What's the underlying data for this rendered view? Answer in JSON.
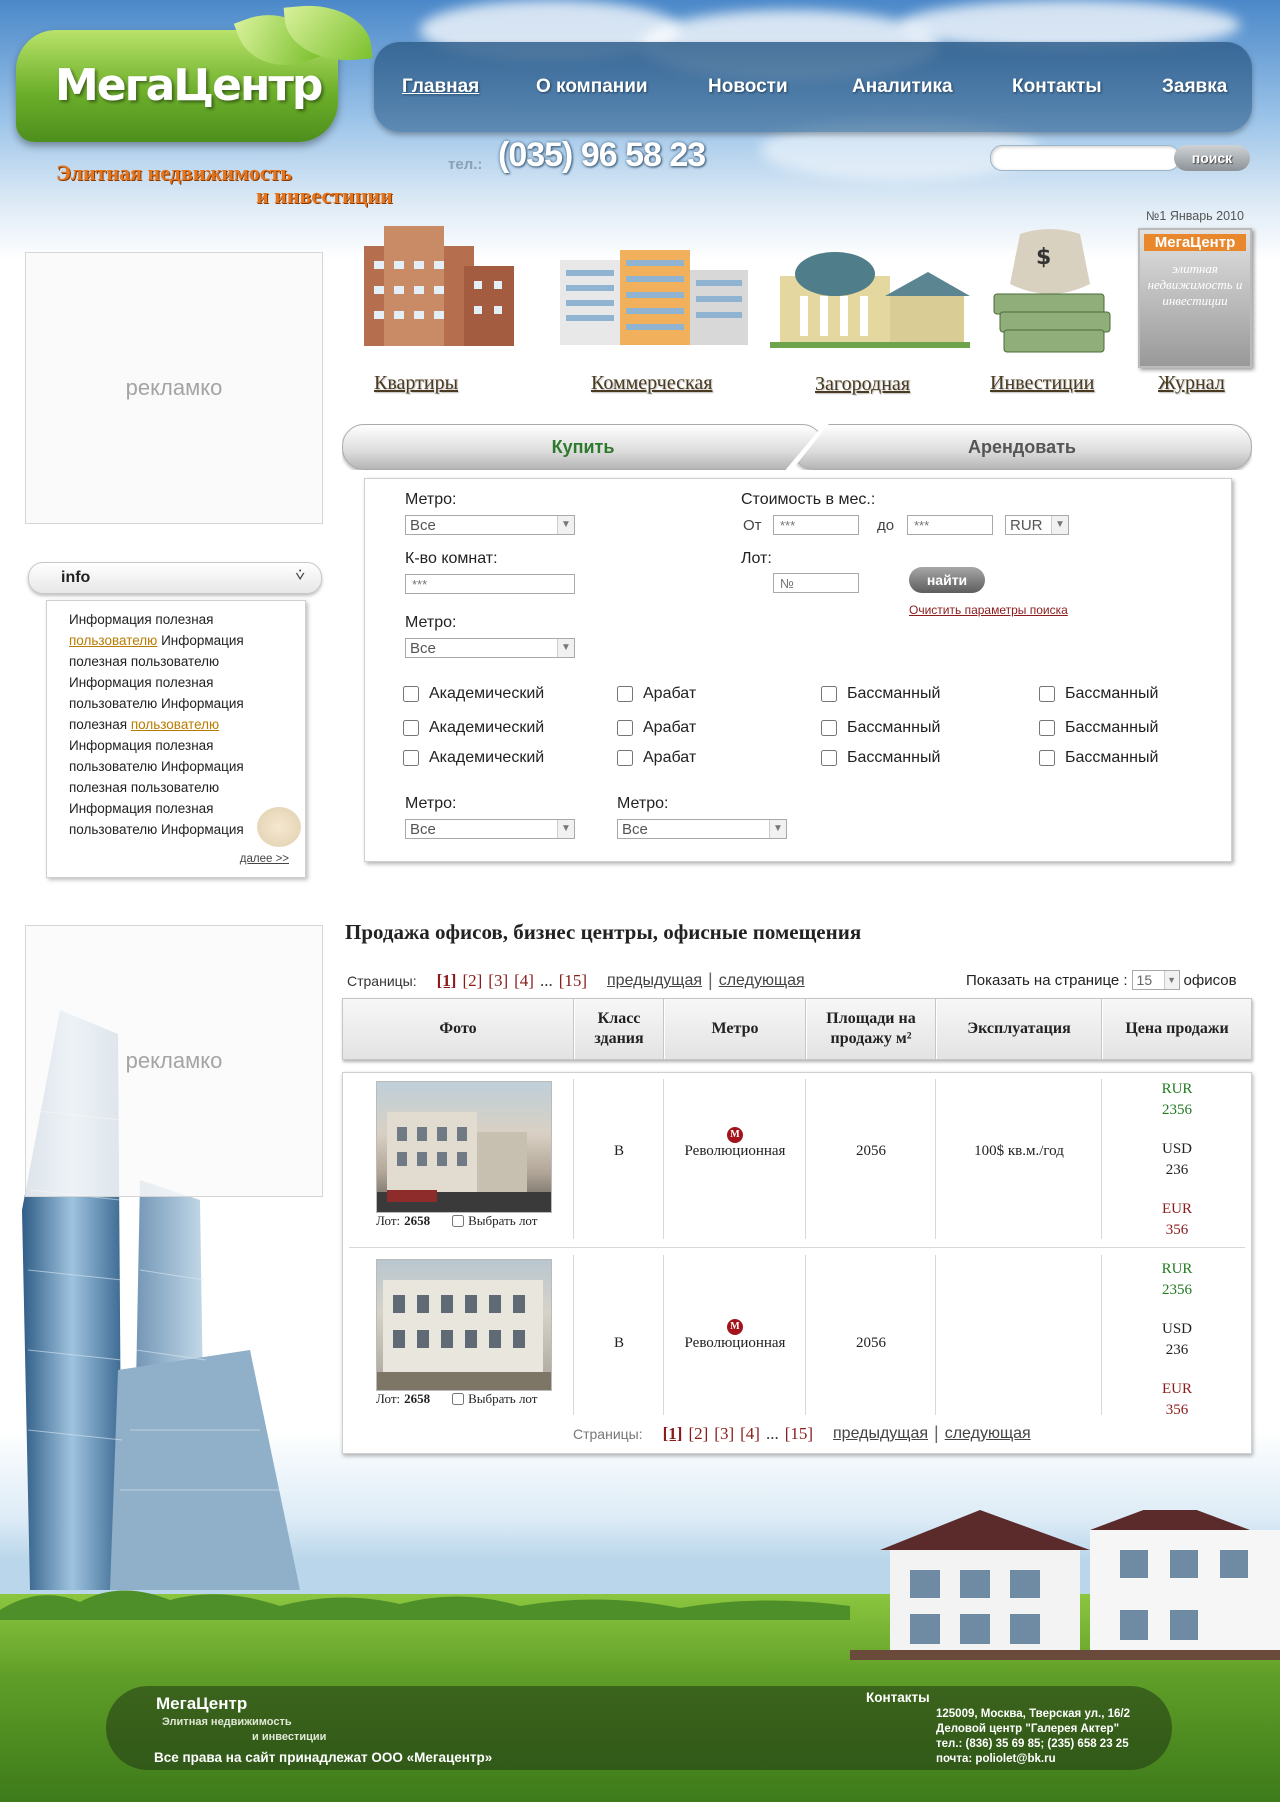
{
  "brand": {
    "name": "МегаЦентр",
    "slogan_line1": "Элитная недвижимость",
    "slogan_line2": "и инвестиции",
    "phone_label": "тел.:",
    "phone": "(035) 96 58 23"
  },
  "nav": {
    "items": [
      "Главная",
      "О компании",
      "Новости",
      "Аналитика",
      "Контакты",
      "Заявка"
    ],
    "active": "Главная"
  },
  "search": {
    "value": "",
    "button_label": "поиск"
  },
  "sidebar": {
    "ad1_text": "рекламко",
    "ad2_text": "рекламко",
    "info": {
      "title": "info",
      "text": [
        {
          "t": "Информация полезная ",
          "link": false
        },
        {
          "t": "пользователю",
          "link": true
        },
        {
          "t": " Информация полезная пользователю Информация полезная пользователю Информация полезная ",
          "link": false
        },
        {
          "t": "пользователю",
          "link": true
        },
        {
          "t": " Информация полезная пользователю Информация полезная пользователю Информация полезная пользователю Информация",
          "link": false
        }
      ],
      "more_label": "далее >>"
    }
  },
  "categories": {
    "items": [
      "Квартиры",
      "Коммерческая",
      "Загородная",
      "Инвестиции",
      "Журнал"
    ],
    "journal_issue": "№1 Январь 2010",
    "journal_brand": "МегаЦентр",
    "journal_cover_text": "элитная недвижимость и инвестиции",
    "money_symbol": "$"
  },
  "tabs": {
    "buy": "Купить",
    "rent": "Арендовать",
    "active": "buy"
  },
  "form": {
    "metro_label": "Метро:",
    "metro_value": "Все",
    "rooms_label": "К-во комнат:",
    "rooms_placeholder": "***",
    "metro2_label": "Метро:",
    "metro2_value": "Все",
    "cost_label": "Стоимость в мес.:",
    "from_label": "От",
    "from_placeholder": "***",
    "to_label": "до",
    "to_placeholder": "***",
    "currency": "RUR",
    "lot_label": "Лот:",
    "lot_placeholder": "№",
    "find_button": "найти",
    "clear_link": "Очистить параметры поиска",
    "checkbox_rows": [
      [
        "Академический",
        "Арабат",
        "Бассманный",
        "Бассманный"
      ],
      [
        "Академический",
        "Арабат",
        "Бассманный",
        "Бассманный"
      ],
      [
        "Академический",
        "Арабат",
        "Бассманный",
        "Бассманный"
      ]
    ],
    "metro3_label": "Метро:",
    "metro3_value": "Все",
    "metro4_label": "Метро:",
    "metro4_value": "Все"
  },
  "listing": {
    "title": "Продажа офисов, бизнес центры, офисные помещения",
    "pages_label": "Страницы:",
    "pages": [
      "[1]",
      "[2]",
      "[3]",
      "[4]"
    ],
    "dots": "...",
    "last_page": "[15]",
    "prev": "предыдущая",
    "next": "следующая",
    "separator": "|",
    "per_page_label": "Показать на странице :",
    "per_page_value": "15",
    "per_page_unit": "офисов",
    "columns": [
      "Фото",
      "Класс здания",
      "Метро",
      "Площади на продажу м²",
      "Эксплуатация",
      "Цена продажи"
    ],
    "rows": [
      {
        "lot_label": "Лот:",
        "lot": "2658",
        "select_label": "Выбрать лот",
        "class": "B",
        "metro": "Революционная",
        "metro_icon": "М",
        "area": "2056",
        "operation": "100$ кв.м./год",
        "rur_label": "RUR",
        "rur": "2356",
        "usd_label": "USD",
        "usd": "236",
        "eur_label": "EUR",
        "eur": "356"
      },
      {
        "lot_label": "Лот:",
        "lot": "2658",
        "select_label": "Выбрать лот",
        "class": "B",
        "metro": "Революционная",
        "metro_icon": "М",
        "area": "2056",
        "operation": "",
        "rur_label": "RUR",
        "rur": "2356",
        "usd_label": "USD",
        "usd": "236",
        "eur_label": "EUR",
        "eur": "356"
      }
    ]
  },
  "footer": {
    "brand": "МегаЦентр",
    "slogan1": "Элитная недвижимость",
    "slogan2": "и инвестиции",
    "copyright": "Все права на сайт принадлежат ООО «Мегацентр»",
    "contacts_title": "Контакты",
    "address": "125009, Москва, Тверская ул., 16/2",
    "center": "Деловой центр \"Галерея Актер\"",
    "phones": "тел.: (836) 35 69 85; (235) 658 23 25",
    "email": "почта: poliolet@bk.ru"
  },
  "colors": {
    "accent_green": "#6db02b",
    "nav_blue": "#3a6f9e",
    "link_red": "#8b1a1a",
    "price_green": "#217a21"
  }
}
